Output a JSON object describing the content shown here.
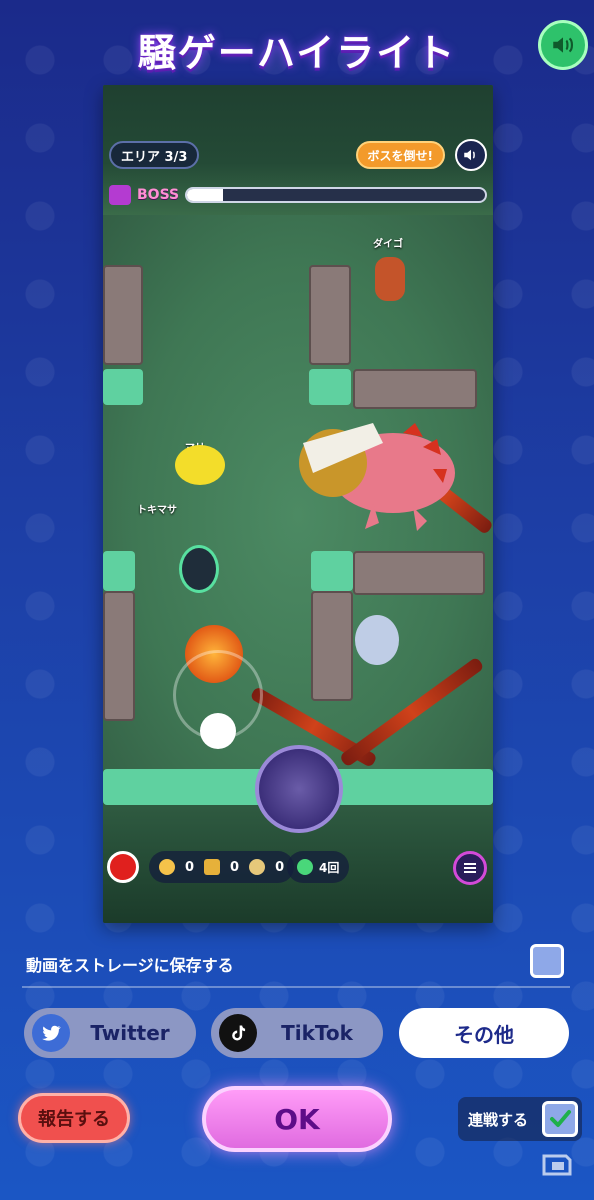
{
  "title": "騒ゲーハイライト",
  "game": {
    "area": "エリア 3/3",
    "boss_cta": "ボスを倒せ!",
    "boss_label": "BOSS",
    "boss_hp_fraction": 0.12,
    "characters": [
      "ダイゴ",
      "マリ",
      "トキマサ"
    ],
    "counters": [
      "0",
      "0",
      "0"
    ],
    "gems": "4回",
    "colors": {
      "lava": "#d0421a",
      "boss": "#e8798a",
      "floor": "#3f7754"
    }
  },
  "save_label": "動画をストレージに保存する",
  "share": {
    "twitter": "Twitter",
    "tiktok": "TikTok",
    "other": "その他"
  },
  "buttons": {
    "report": "報告する",
    "ok": "OK",
    "rensen": "連戦する"
  },
  "icons": {
    "sound": "speaker-icon",
    "twitter": "twitter-bird-icon",
    "tiktok": "tiktok-note-icon",
    "check": "check-icon",
    "menu": "menu-icon",
    "record": "record-icon"
  }
}
